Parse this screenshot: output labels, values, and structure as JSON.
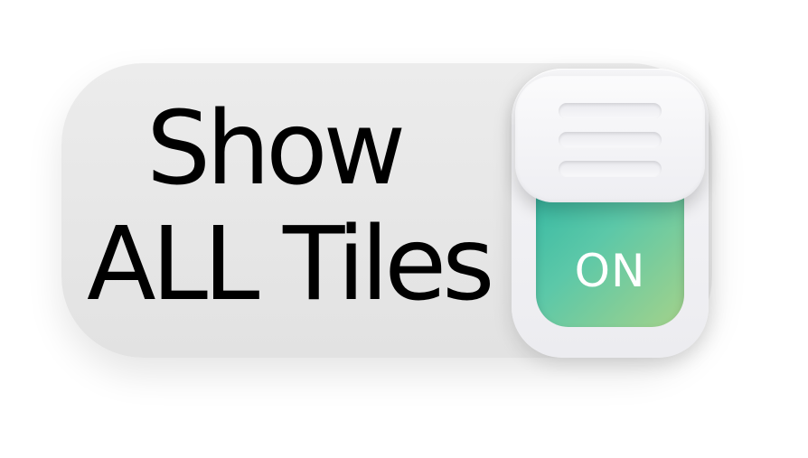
{
  "toggle": {
    "label_line1": "Show",
    "label_line2": "ALL Tiles",
    "state_text": "ON",
    "is_on": true,
    "accent_gradient": [
      "#2fb6a2",
      "#a4d28a"
    ],
    "knob_icon": "grip-lines-icon"
  }
}
